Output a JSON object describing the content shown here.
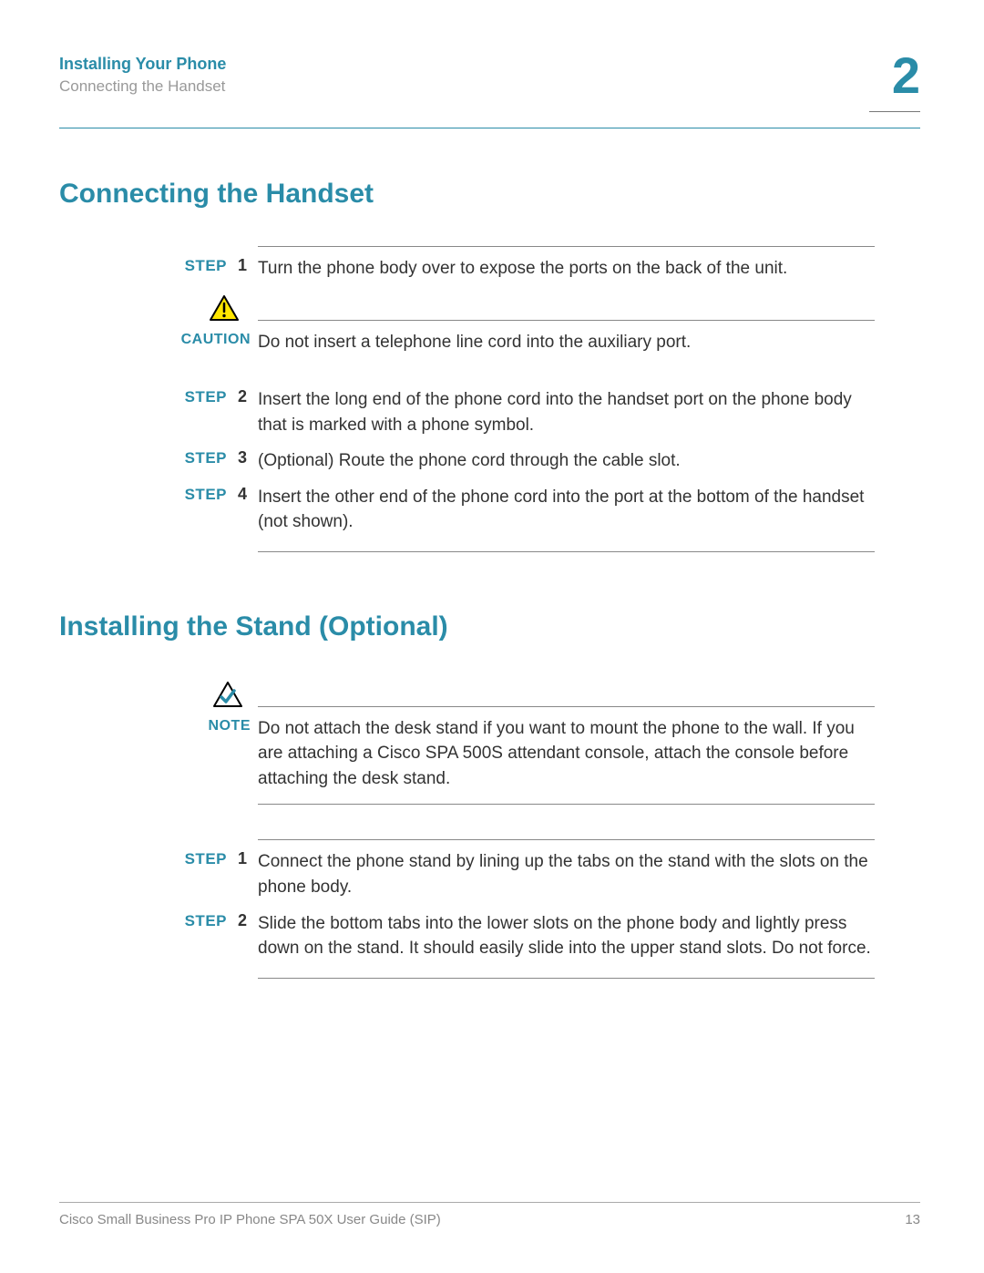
{
  "header": {
    "title": "Installing Your Phone",
    "subtitle": "Connecting the Handset",
    "chapter": "2"
  },
  "section1": {
    "title": "Connecting the Handset",
    "step1": {
      "label": "STEP",
      "num": "1",
      "text": "Turn the phone body over to expose the ports on the back of the unit."
    },
    "caution": {
      "label": "CAUTION",
      "text": "Do not insert a telephone line cord into the auxiliary port."
    },
    "step2": {
      "label": "STEP",
      "num": "2",
      "text": "Insert the long end of the phone cord into the handset port on the phone body that is marked with a phone symbol."
    },
    "step3": {
      "label": "STEP",
      "num": "3",
      "text": "(Optional) Route the phone cord through the cable slot."
    },
    "step4": {
      "label": "STEP",
      "num": "4",
      "text": "Insert the other end of the phone cord into the port at the bottom of the handset (not shown)."
    }
  },
  "section2": {
    "title": "Installing the Stand (Optional)",
    "note": {
      "label": "NOTE",
      "text": "Do not attach the desk stand if you want to mount the phone to the wall. If you are attaching a Cisco SPA 500S attendant console, attach the console before attaching the desk stand."
    },
    "step1": {
      "label": "STEP",
      "num": "1",
      "text": "Connect the phone stand by lining up the tabs on the stand with the slots on the phone body."
    },
    "step2": {
      "label": "STEP",
      "num": "2",
      "text": "Slide the bottom tabs into the lower slots on the phone body and lightly press down on the stand. It should easily slide into the upper stand slots. Do not force."
    }
  },
  "footer": {
    "guide": "Cisco Small Business Pro IP Phone SPA 50X User Guide (SIP)",
    "page": "13"
  }
}
